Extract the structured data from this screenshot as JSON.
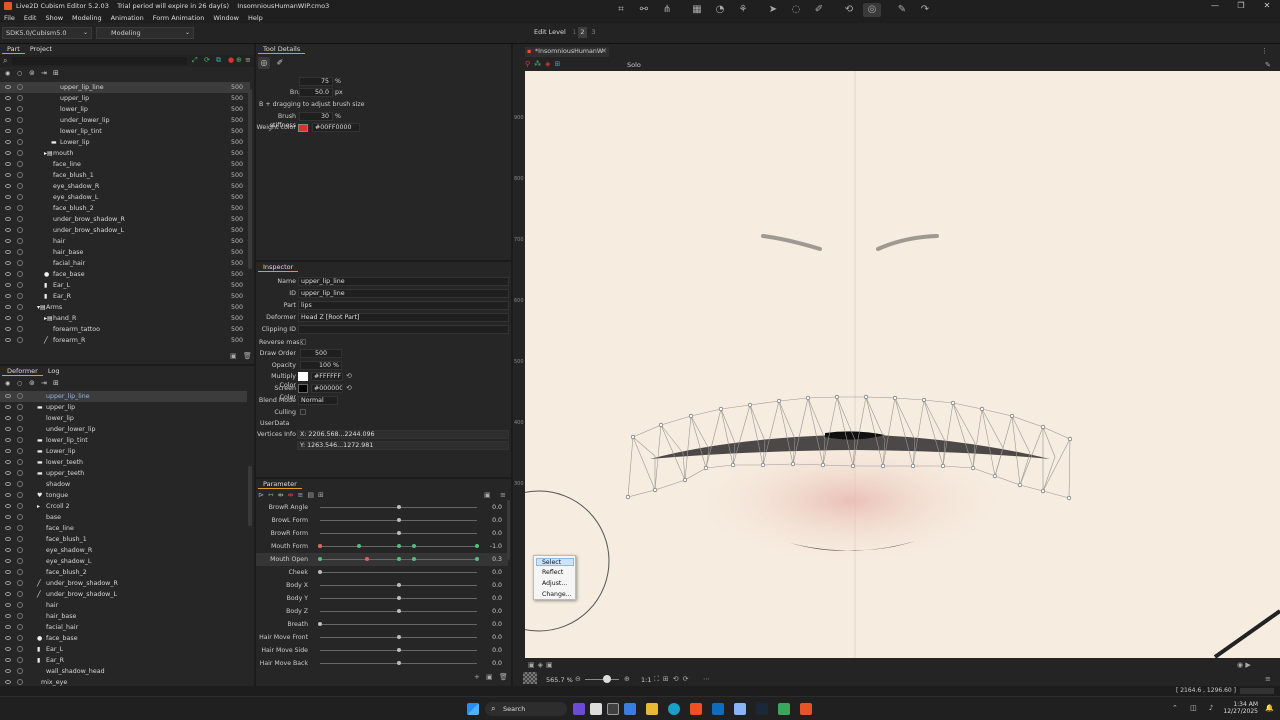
{
  "window": {
    "title": "Live2D Cubism Editor 5.2.03    Trial period will expire in 26 day(s)    InsomniousHumanWIP.cmo3",
    "controls": [
      "—",
      "❐",
      "✕"
    ]
  },
  "menu": [
    "File",
    "Edit",
    "Show",
    "Modeling",
    "Animation",
    "Form Animation",
    "Window",
    "Help"
  ],
  "toolbar": {
    "sdk_select": "SDK5.0/Cubism5.0",
    "mode_select": "Modeling",
    "edit_level_label": "Edit Level",
    "edit_levels": [
      "1",
      "2",
      "3"
    ]
  },
  "part_panel": {
    "tabs": [
      "Part",
      "Project"
    ],
    "rows": [
      {
        "name": "upper_lip_line",
        "num": "500",
        "indent": 60,
        "selected": true,
        "glyph": ""
      },
      {
        "name": "upper_lip",
        "num": "500",
        "indent": 60,
        "glyph": ""
      },
      {
        "name": "lower_lip",
        "num": "500",
        "indent": 60,
        "glyph": ""
      },
      {
        "name": "under_lower_lip",
        "num": "500",
        "indent": 60,
        "glyph": ""
      },
      {
        "name": "lower_lip_tint",
        "num": "500",
        "indent": 60,
        "glyph": ""
      },
      {
        "name": "Lower_lip",
        "num": "500",
        "indent": 60,
        "glyph": "▬"
      },
      {
        "name": "mouth",
        "num": "500",
        "indent": 53,
        "glyph": "▸▤"
      },
      {
        "name": "face_line",
        "num": "500",
        "indent": 53,
        "glyph": ""
      },
      {
        "name": "face_blush_1",
        "num": "500",
        "indent": 53,
        "glyph": ""
      },
      {
        "name": "eye_shadow_R",
        "num": "500",
        "indent": 53,
        "glyph": ""
      },
      {
        "name": "eye_shadow_L",
        "num": "500",
        "indent": 53,
        "glyph": ""
      },
      {
        "name": "face_blush_2",
        "num": "500",
        "indent": 53,
        "glyph": ""
      },
      {
        "name": "under_brow_shadow_R",
        "num": "500",
        "indent": 53,
        "glyph": ""
      },
      {
        "name": "under_brow_shadow_L",
        "num": "500",
        "indent": 53,
        "glyph": ""
      },
      {
        "name": "hair",
        "num": "500",
        "indent": 53,
        "glyph": ""
      },
      {
        "name": "hair_base",
        "num": "500",
        "indent": 53,
        "glyph": ""
      },
      {
        "name": "facial_hair",
        "num": "500",
        "indent": 53,
        "glyph": ""
      },
      {
        "name": "face_base",
        "num": "500",
        "indent": 53,
        "glyph": "●"
      },
      {
        "name": "Ear_L",
        "num": "500",
        "indent": 53,
        "glyph": "▮"
      },
      {
        "name": "Ear_R",
        "num": "500",
        "indent": 53,
        "glyph": "▮"
      },
      {
        "name": "Arms",
        "num": "500",
        "indent": 46,
        "glyph": "▾▤"
      },
      {
        "name": "hand_R",
        "num": "500",
        "indent": 53,
        "glyph": "▸▤"
      },
      {
        "name": "forearm_tattoo",
        "num": "500",
        "indent": 53,
        "glyph": ""
      },
      {
        "name": "forearm_R",
        "num": "500",
        "indent": 53,
        "glyph": "╱"
      }
    ]
  },
  "deformer_panel": {
    "tabs": [
      "Deformer",
      "Log"
    ],
    "rows": [
      {
        "name": "upper_lip_line",
        "indent": 46,
        "selected": true,
        "glyph": ""
      },
      {
        "name": "upper_lip",
        "indent": 46,
        "glyph": "▬"
      },
      {
        "name": "lower_lip",
        "indent": 46,
        "glyph": ""
      },
      {
        "name": "under_lower_lip",
        "indent": 46,
        "glyph": ""
      },
      {
        "name": "lower_lip_tint",
        "indent": 46,
        "glyph": "▬"
      },
      {
        "name": "Lower_lip",
        "indent": 46,
        "glyph": "▬"
      },
      {
        "name": "lower_teeth",
        "indent": 46,
        "glyph": "▬"
      },
      {
        "name": "upper_teeth",
        "indent": 46,
        "glyph": "▬"
      },
      {
        "name": "shadow",
        "indent": 46,
        "glyph": ""
      },
      {
        "name": "tongue",
        "indent": 46,
        "glyph": "♥"
      },
      {
        "name": "Crcoll 2",
        "indent": 46,
        "glyph": "▸"
      },
      {
        "name": "base",
        "indent": 46,
        "glyph": ""
      },
      {
        "name": "face_line",
        "indent": 46,
        "glyph": ""
      },
      {
        "name": "face_blush_1",
        "indent": 46,
        "glyph": ""
      },
      {
        "name": "eye_shadow_R",
        "indent": 46,
        "glyph": ""
      },
      {
        "name": "eye_shadow_L",
        "indent": 46,
        "glyph": ""
      },
      {
        "name": "face_blush_2",
        "indent": 46,
        "glyph": ""
      },
      {
        "name": "under_brow_shadow_R",
        "indent": 46,
        "glyph": "╱"
      },
      {
        "name": "under_brow_shadow_L",
        "indent": 46,
        "glyph": "╱"
      },
      {
        "name": "hair",
        "indent": 46,
        "glyph": ""
      },
      {
        "name": "hair_base",
        "indent": 46,
        "glyph": ""
      },
      {
        "name": "facial_hair",
        "indent": 46,
        "glyph": ""
      },
      {
        "name": "face_base",
        "indent": 46,
        "glyph": "●"
      },
      {
        "name": "Ear_L",
        "indent": 46,
        "glyph": "▮"
      },
      {
        "name": "Ear_R",
        "indent": 46,
        "glyph": "▮"
      },
      {
        "name": "wall_shadow_head",
        "indent": 46,
        "glyph": ""
      },
      {
        "name": "mix_eye",
        "indent": 41,
        "glyph": ""
      }
    ]
  },
  "tool_details": {
    "title": "Tool Details",
    "weight_label": "Weight",
    "weight_value": "75",
    "weight_unit": "%",
    "brush_size_label": "Brush Size",
    "brush_size_value": "50.0",
    "brush_size_unit": "px",
    "hint": "B + dragging to adjust brush size",
    "stiffness_label": "Brush stiffness",
    "stiffness_value": "30",
    "stiffness_unit": "%",
    "weight_color_label": "Weight color",
    "weight_color_value": "#00FF0000",
    "weight_color_swatch": "#e0302a"
  },
  "inspector": {
    "title": "Inspector",
    "fields": [
      {
        "label": "Name",
        "value": "upper_lip_line"
      },
      {
        "label": "ID",
        "value": "upper_lip_line"
      },
      {
        "label": "Part",
        "value": "lips"
      },
      {
        "label": "Deformer",
        "value": "Head Z  [Root Part]"
      },
      {
        "label": "Clipping ID",
        "value": ""
      }
    ],
    "reverse_mask": "Reverse mask",
    "draw_order_label": "Draw Order",
    "draw_order_value": "500",
    "opacity_label": "Opacity",
    "opacity_value": "100 %",
    "multiply_label": "Multiply Color",
    "multiply_value": "#FFFFFF",
    "screen_label": "Screen Color",
    "screen_value": "#000000",
    "blend_label": "Blend Mode",
    "blend_value": "Normal",
    "culling": "Culling",
    "userdata": "UserData",
    "vertices_label": "Vertices Info",
    "vertices_x": "X: 2206.568...2244.096",
    "vertices_y": "Y: 1263.546...1272.981"
  },
  "parameter": {
    "title": "Parameter",
    "rows": [
      {
        "label": "BrowR Angle",
        "value": "0.0",
        "knob": 0.5
      },
      {
        "label": "BrowL Form",
        "value": "0.0",
        "knob": 0.5
      },
      {
        "label": "BrowR Form",
        "value": "0.0",
        "knob": 0.5
      },
      {
        "label": "Mouth Form",
        "value": "-1.0",
        "knob": 0.0,
        "keys": [
          0.0,
          0.25,
          0.5,
          0.6,
          1.0
        ]
      },
      {
        "label": "Mouth Open",
        "value": "0.3",
        "knob": 0.3,
        "keys": [
          0.0,
          0.5,
          0.6,
          1.0
        ],
        "highlight": true
      },
      {
        "label": "Cheek",
        "value": "0.0",
        "knob": 0.0
      },
      {
        "label": "Body X",
        "value": "0.0",
        "knob": 0.5
      },
      {
        "label": "Body Y",
        "value": "0.0",
        "knob": 0.5
      },
      {
        "label": "Body Z",
        "value": "0.0",
        "knob": 0.5
      },
      {
        "label": "Breath",
        "value": "0.0",
        "knob": 0.0
      },
      {
        "label": "Hair Move Front",
        "value": "0.0",
        "knob": 0.5
      },
      {
        "label": "Hair Move Side",
        "value": "0.0",
        "knob": 0.5
      },
      {
        "label": "Hair Move Back",
        "value": "0.0",
        "knob": 0.5
      }
    ]
  },
  "canvas": {
    "tab_title": "*InsomniousHumanW",
    "solo_label": "Solo",
    "ruler_ticks": [
      "900",
      "800",
      "700",
      "600",
      "500",
      "400",
      "300"
    ],
    "zoom": "565.7 %",
    "ratio": "1:1",
    "coordinates": "[ 2164.6 , 1296.60 ]",
    "background": "#f6ecdf"
  },
  "context_menu": [
    "Select",
    "Reflect",
    "Adjust...",
    "Change..."
  ],
  "taskbar": {
    "search": "Search",
    "time": "1:34 AM",
    "date": "12/27/2025"
  }
}
